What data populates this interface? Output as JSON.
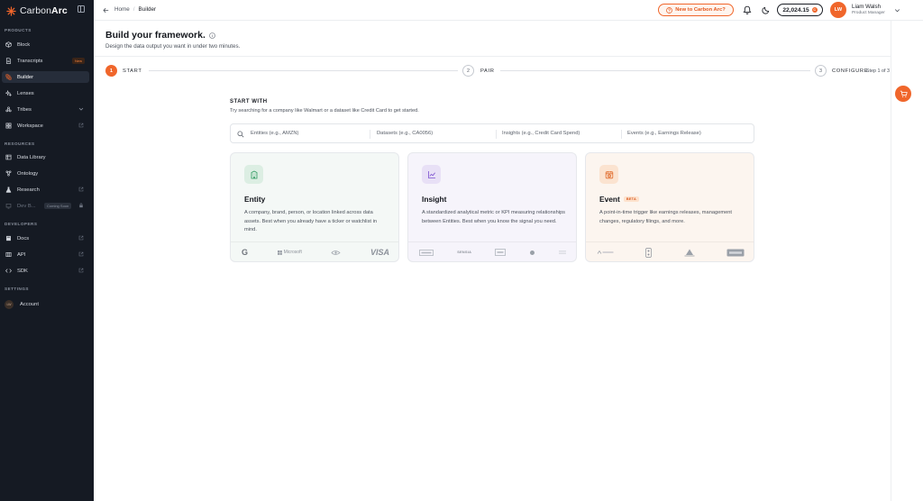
{
  "app": {
    "brand_prefix": "Carbon",
    "brand_suffix": "Arc"
  },
  "sidebar": {
    "sections": [
      "PRODUCTS",
      "RESOURCES",
      "DEVELOPERS",
      "SETTINGS"
    ],
    "items": [
      {
        "label": "Block"
      },
      {
        "label": "Transcripts",
        "badge": "New"
      },
      {
        "label": "Builder",
        "active": true
      },
      {
        "label": "Lenses"
      },
      {
        "label": "Tribes"
      },
      {
        "label": "Workspace"
      },
      {
        "label": "Data Library"
      },
      {
        "label": "Ontology"
      },
      {
        "label": "Research"
      },
      {
        "label": "Dev B...",
        "badge": "Coming Soon"
      },
      {
        "label": "Docs"
      },
      {
        "label": "API"
      },
      {
        "label": "SDK"
      },
      {
        "label": "Account",
        "avatar": "LW"
      }
    ]
  },
  "topbar": {
    "breadcrumb": [
      "Home",
      "Builder"
    ],
    "promo_label": "New to Carbon Arc?",
    "credits": "22,024.15",
    "credits_icon": "C",
    "user_initials": "LW",
    "user_name": "Liam Walsh",
    "user_role": "Product Manager"
  },
  "page": {
    "title": "Build your framework.",
    "subtitle": "Design the data output you want in under two minutes."
  },
  "stepper": {
    "steps": [
      {
        "num": "1",
        "label": "START"
      },
      {
        "num": "2",
        "label": "PAIR"
      },
      {
        "num": "3",
        "label": "CONFIGURE"
      }
    ],
    "count": "Step 1 of 3"
  },
  "start": {
    "heading": "START WITH",
    "hint": "Try searching for a company like Walmart or a dataset like Credit Card to get started.",
    "fields": [
      "Entities (e.g., AMZN)",
      "Datasets (e.g., CA0056)",
      "Insights (e.g., Credit Card Spend)",
      "Events (e.g., Earnings Release)"
    ]
  },
  "cards": [
    {
      "title": "Entity",
      "desc": "A company, brand, person, or location linked across data assets. Best when you already have a ticker or watchlist in mind.",
      "logos": [
        "G",
        "Microsoft",
        "VISA"
      ]
    },
    {
      "title": "Insight",
      "desc": "A standardized analytical metric or KPI measuring relationships between Entities. Best when you know the signal you need.",
      "logos": [
        "SENSIA"
      ]
    },
    {
      "title": "Event",
      "badge": "BETA",
      "desc": "A point-in-time trigger like earnings releases, management changes, regulatory filings, and more.",
      "logos": []
    }
  ],
  "colors": {
    "accent": "#f0662b",
    "sidebar_bg": "#151a23",
    "entity_card": "#f4f8f6",
    "insight_card": "#f6f4fb",
    "event_card": "#fcf5ef"
  }
}
